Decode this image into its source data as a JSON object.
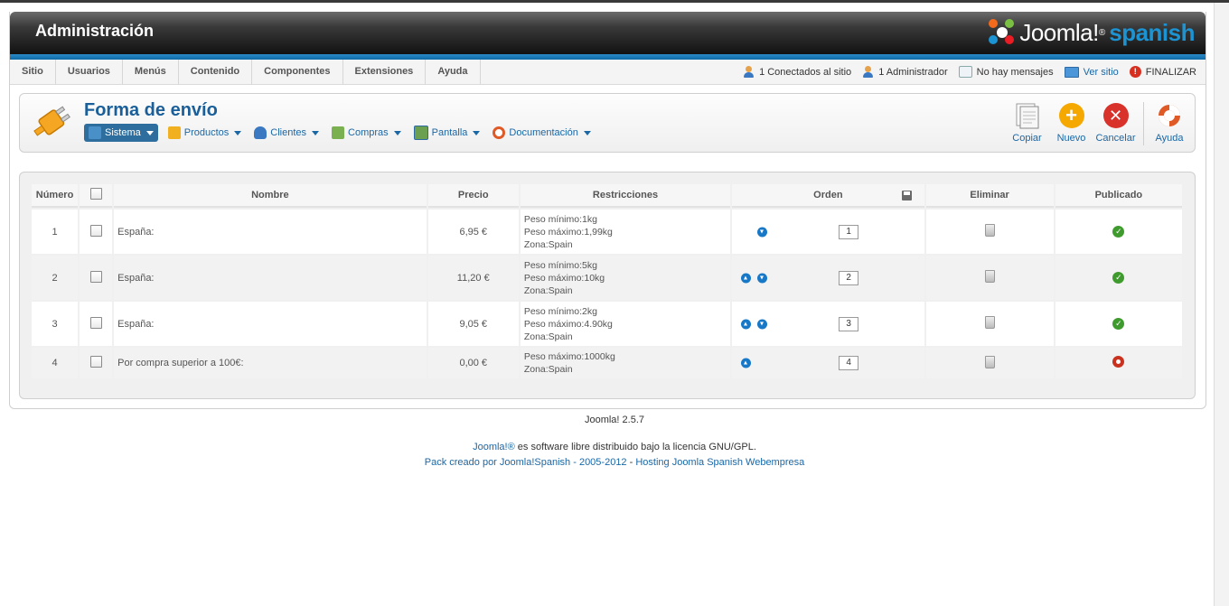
{
  "header": {
    "title": "Administración",
    "logo_word": "Joomla!",
    "logo_reg": "®",
    "logo_lang": "spanish"
  },
  "menu": [
    "Sitio",
    "Usuarios",
    "Menús",
    "Contenido",
    "Componentes",
    "Extensiones",
    "Ayuda"
  ],
  "status": {
    "connected": "1 Conectados al sitio",
    "admin": "1 Administrador",
    "messages": "No hay mensajes",
    "view_site": "Ver sitio",
    "logout": "FINALIZAR"
  },
  "toolbar": {
    "title": "Forma de envío",
    "submenu": [
      {
        "label": "Sistema",
        "icon": "wrench-icon",
        "color": "#4a90c8"
      },
      {
        "label": "Productos",
        "icon": "box-icon",
        "color": "#f0b020"
      },
      {
        "label": "Clientes",
        "icon": "users-icon",
        "color": "#3a78c2"
      },
      {
        "label": "Compras",
        "icon": "cart-icon",
        "color": "#7ab050"
      },
      {
        "label": "Pantalla",
        "icon": "display-icon",
        "color": "#6aa050"
      },
      {
        "label": "Documentación",
        "icon": "lifebuoy-icon",
        "color": "#e05a28"
      }
    ],
    "buttons": {
      "copy": "Copiar",
      "new": "Nuevo",
      "cancel": "Cancelar",
      "help": "Ayuda"
    }
  },
  "table": {
    "headers": {
      "num": "Número",
      "name": "Nombre",
      "price": "Precio",
      "restr": "Restricciones",
      "order": "Orden",
      "delete": "Eliminar",
      "published": "Publicado"
    },
    "rows": [
      {
        "num": "1",
        "name": "España:",
        "price": "6,95 €",
        "restr": [
          "Peso mínimo:1kg",
          "Peso máximo:1,99kg",
          "Zona:Spain"
        ],
        "up": false,
        "down": true,
        "order": "1",
        "published": true
      },
      {
        "num": "2",
        "name": "España:",
        "price": "11,20 €",
        "restr": [
          "Peso mínimo:5kg",
          "Peso máximo:10kg",
          "Zona:Spain"
        ],
        "up": true,
        "down": true,
        "order": "2",
        "published": true
      },
      {
        "num": "3",
        "name": "España:",
        "price": "9,05 €",
        "restr": [
          "Peso mínimo:2kg",
          "Peso máximo:4.90kg",
          "Zona:Spain"
        ],
        "up": true,
        "down": true,
        "order": "3",
        "published": true
      },
      {
        "num": "4",
        "name": "Por compra superior a 100€:",
        "price": "0,00 €",
        "restr": [
          "Peso máximo:1000kg",
          "Zona:Spain"
        ],
        "up": true,
        "down": false,
        "order": "4",
        "published": false
      }
    ]
  },
  "footer": {
    "version": "Joomla! 2.5.7",
    "license_link": "Joomla!®",
    "license_text": " es software libre distribuido bajo la licencia GNU/GPL.",
    "pack_link": "Pack creado por Joomla!Spanish - 2005-2012",
    "sep": " - ",
    "hosting_link": "Hosting Joomla Spanish Webempresa"
  }
}
